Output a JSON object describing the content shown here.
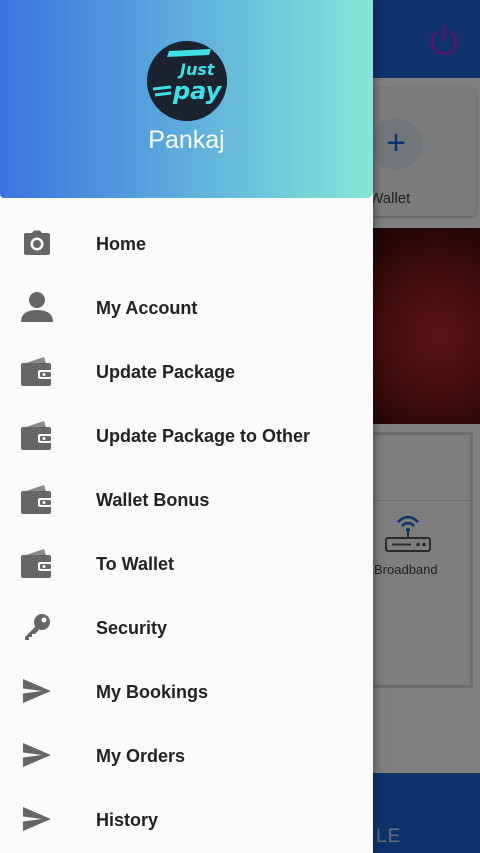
{
  "colors": {
    "primary": "#1f64d6",
    "header_gradient_start": "#3a73e0",
    "header_gradient_end": "#86e6d8",
    "icon_gray": "#666666",
    "label_text": "#222222"
  },
  "drawer": {
    "logo_text_top": "Just",
    "logo_text_bottom": "pay",
    "user_name": "Pankaj",
    "items": [
      {
        "label": "Home",
        "icon": "camera-icon"
      },
      {
        "label": "My Account",
        "icon": "person-icon"
      },
      {
        "label": "Update Package",
        "icon": "wallet-icon"
      },
      {
        "label": "Update Package to Other",
        "icon": "wallet-icon"
      },
      {
        "label": "Wallet Bonus",
        "icon": "wallet-icon"
      },
      {
        "label": "To Wallet",
        "icon": "wallet-icon"
      },
      {
        "label": "Security",
        "icon": "key-icon"
      },
      {
        "label": "My Bookings",
        "icon": "send-icon"
      },
      {
        "label": "My Orders",
        "icon": "send-icon"
      },
      {
        "label": "History",
        "icon": "send-icon"
      }
    ]
  },
  "background": {
    "card_label": "oup Wallet",
    "tile_label": "Broadband",
    "bottom_text": "LE"
  }
}
